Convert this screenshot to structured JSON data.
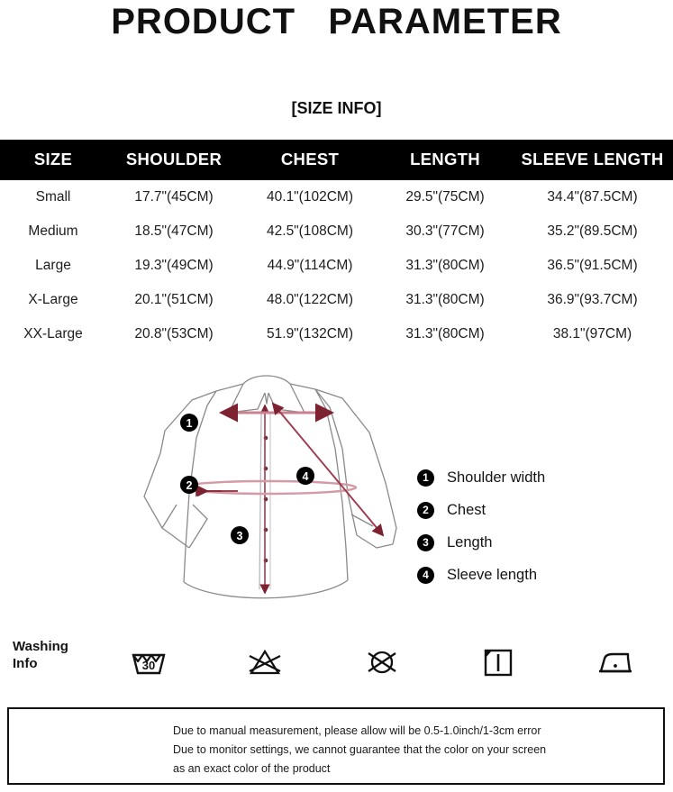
{
  "header": {
    "title": "PRODUCT   PARAMETER",
    "subtitle": "[SIZE INFO]"
  },
  "size_table": {
    "columns": [
      "SIZE",
      "SHOULDER",
      "CHEST",
      "LENGTH",
      "SLEEVE LENGTH"
    ],
    "rows": [
      {
        "size": "Small",
        "shoulder": "17.7\"(45CM)",
        "chest": "40.1\"(102CM)",
        "length": "29.5\"(75CM)",
        "sleeve": "34.4\"(87.5CM)"
      },
      {
        "size": "Medium",
        "shoulder": "18.5\"(47CM)",
        "chest": "42.5\"(108CM)",
        "length": "30.3\"(77CM)",
        "sleeve": "35.2\"(89.5CM)"
      },
      {
        "size": "Large",
        "shoulder": "19.3\"(49CM)",
        "chest": "44.9\"(114CM)",
        "length": "31.3\"(80CM)",
        "sleeve": "36.5\"(91.5CM)"
      },
      {
        "size": "X-Large",
        "shoulder": "20.1\"(51CM)",
        "chest": "48.0\"(122CM)",
        "length": "31.3\"(80CM)",
        "sleeve": "36.9\"(93.7CM)"
      },
      {
        "size": "XX-Large",
        "shoulder": "20.8\"(53CM)",
        "chest": "51.9\"(132CM)",
        "length": "31.3\"(80CM)",
        "sleeve": "38.1\"(97CM)"
      }
    ]
  },
  "diagram": {
    "markers": [
      "1",
      "2",
      "3",
      "4"
    ],
    "outline_color": "#8a8a8a",
    "measure_color": "#9e3b4e"
  },
  "legend": {
    "items": [
      {
        "number": "1",
        "label": "Shoulder width"
      },
      {
        "number": "2",
        "label": "Chest"
      },
      {
        "number": "3",
        "label": "Length"
      },
      {
        "number": "4",
        "label": "Sleeve length"
      }
    ]
  },
  "washing": {
    "label_line1": "Washing",
    "label_line2": "Info",
    "icons": [
      {
        "name": "wash-30-icon",
        "temperature": "30"
      },
      {
        "name": "do-not-bleach-icon"
      },
      {
        "name": "do-not-dry-clean-icon"
      },
      {
        "name": "line-dry-in-shade-icon"
      },
      {
        "name": "iron-low-heat-icon"
      }
    ]
  },
  "footer": {
    "lines": [
      "Due to manual measurement, please allow will be 0.5-1.0inch/1-3cm error",
      "Due to monitor settings, we cannot guarantee that the color on your screen",
      "as an exact color of the product"
    ]
  }
}
